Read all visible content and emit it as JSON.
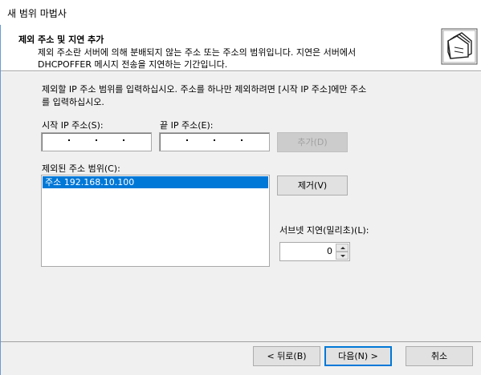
{
  "window": {
    "title": "새 범위 마법사"
  },
  "header": {
    "heading": "제외 주소 및 지연 추가",
    "desc_line1": "제외 주소란 서버에 의해 분배되지 않는 주소 또는 주소의 범위입니다. 지연은 서버에서",
    "desc_line2": "DHCPOFFER 메시지 전송을 지연하는 기간입니다.",
    "icon": "folder-stack-icon"
  },
  "instructions": {
    "line1": "제외할 IP 주소 범위를 입력하십시오. 주소를 하나만 제외하려면 [시작 IP 주소]에만 주소",
    "line2": "를 입력하십시오."
  },
  "start_ip": {
    "label": "시작 IP 주소(S):",
    "value": ""
  },
  "end_ip": {
    "label": "끝 IP 주소(E):",
    "value": ""
  },
  "add_button": {
    "label": "추가(D)",
    "enabled": false
  },
  "excluded": {
    "label": "제외된 주소 범위(C):",
    "items": [
      "주소 192.168.10.100"
    ]
  },
  "remove_button": {
    "label": "제거(V)"
  },
  "subnet_delay": {
    "label": "서브넷 지연(밀리초)(L):",
    "value": "0"
  },
  "footer": {
    "back_label": "< 뒤로(B)",
    "next_label": "다음(N) >",
    "cancel_label": "취소"
  },
  "colors": {
    "selection": "#0078d7",
    "dialog_bg": "#f0f0f0",
    "default_border": "#0078d7"
  }
}
